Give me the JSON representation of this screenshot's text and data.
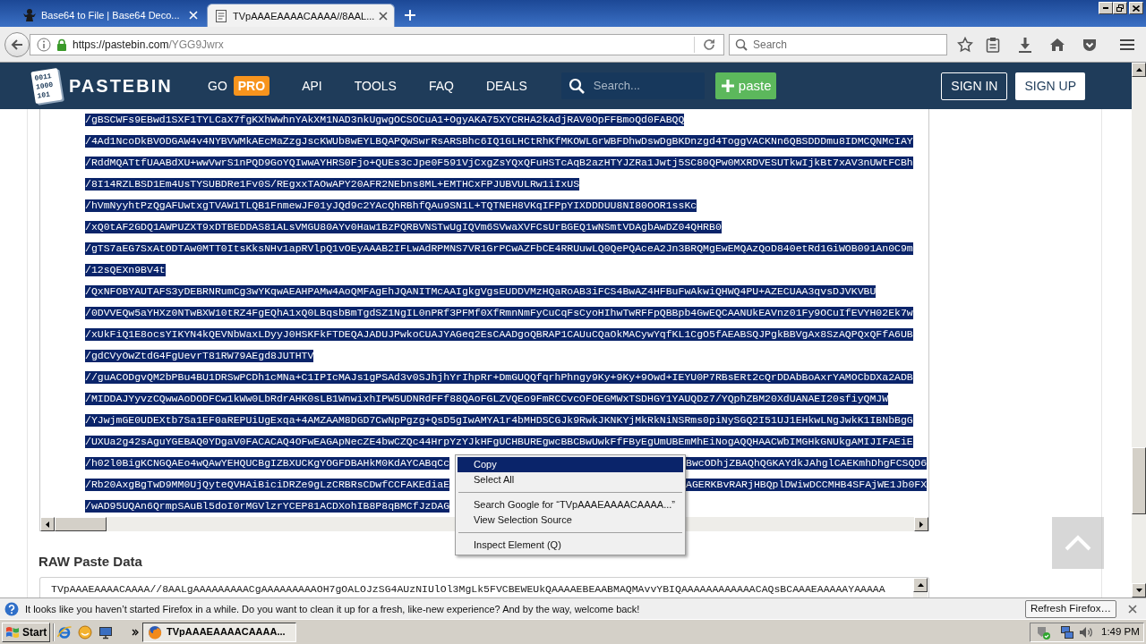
{
  "browser": {
    "tabs": [
      {
        "title": "Base64 to File | Base64 Deco...",
        "selected": false
      },
      {
        "title": "TVpAAAEAAAACAAAA//8AAL...",
        "selected": true
      }
    ],
    "address": {
      "host": "https://pastebin.com",
      "path": "/YGG9Jwrx"
    },
    "search": {
      "placeholder": "Search"
    }
  },
  "site_header": {
    "logo_digits": [
      "0011",
      "1000",
      "101"
    ],
    "logo": "PASTEBIN",
    "nav": [
      {
        "label": "GO",
        "badge": "PRO"
      },
      {
        "label": "API"
      },
      {
        "label": "TOOLS"
      },
      {
        "label": "FAQ"
      },
      {
        "label": "DEALS"
      }
    ],
    "search": {
      "placeholder": "Search..."
    },
    "new_paste": "paste",
    "sign_in": "SIGN IN",
    "sign_up": "SIGN UP"
  },
  "code": {
    "lines": [
      {
        "text": "/gBSCWFs9EBwd1SXF1TYLCaX7fgKXhWwhnYAkXM1NAD3nkUgwgOCSOCuA1+OgyAKA75XYCRHA2kAdjRAV0OpFFBmoQd0FABQQ",
        "selected": true
      },
      {
        "text": "/4Ad1NcoDkBVODGAW4v4NYBVWMkAEcMaZzgJscKWUb8wEYLBQAPQWSwrRsARSBhc6IQ1GLHCtRhKfMKOWLGrWBFDhwDswDgBKDnzgd4ToggVACKNn6QBSDDDmu8IDMCQNMcIAY",
        "selected": true
      },
      {
        "text": "/RddMQATtfUAABdXU+wwVwrS1nPQD9GoYQIwwAYHRS0Fjo+QUEs3cJpe0F591VjCxgZsYQxQFuHSTcAqB2azHTYJZRa1Jwtj5SC80QPw0MXRDVESUTkwIjkBt7xAV3nUWtFCBh",
        "selected": true
      },
      {
        "text": "/8I14RZLBSD1Em4UsTYSUBDRe1Fv0S/REgxxTAOwAPY20AFR2NEbns8ML+EMTHCxFPJUBVULRw1iIxUS",
        "selected": true
      },
      {
        "text": "/hVmNyyhtPzQgAFUwtxgTVAW1TLQB1FnmewJF01yJQd9c2YAcQhRBhfQAu9SN1L+TQTNEH8VKqIFPpYIXDDDUU8NI80OOR1ssKc",
        "selected": true
      },
      {
        "text": "/xQ0tAF2GDQ1AWPUZXT9xDTBEDDAS81ALsVMGU80AYv0Haw1BzPQRBVNSTwUgIQVm6SVwaXVFCsUrBGEQ1wNSmtVDAgbAwDZ04QHRB0",
        "selected": true
      },
      {
        "text": "/gTS7aEG7SxAtODTAw0MTT0ItsKksNHv1apRVlpQ1vOEyAAAB2IFLwAdRPMNS7VR1GrPCwAZFbCE4RRUuwLQ0QePQAceA2Jn3BRQMgEwEMQAzQoD840etRd1GiWOB091An0C9m",
        "selected": true
      },
      {
        "text": "/12sQEXn9BV4t",
        "selected": true
      },
      {
        "text": "/QxNFOBYAUTAFS3yDEBRNRumCg3wYKqwAEAHPAMw4AoQMFAgEhJQANITMcAAIgkgVgsEUDDVMzHQaRoAB3iFCS4BwAZ4HFBuFwAkwiQHWQ4PU+AZECUAA3qvsDJVKVBU",
        "selected": true
      },
      {
        "text": "/0DVVEQw5aYHXz0NTwBXW10tRZ4FgEQhA1xQ0LBqsbBmTgdSZ1NgIL0nPRf3PFMf0XfRmnNmFyCuCqFsCyoHIhwTwRFFpQBBpb4GwEQCAANUkEAVnz01Fy9OCuIfEVYH02Ek7w",
        "selected": true
      },
      {
        "text": "/xUkFiQ1E8ocsYIKYN4kQEVNbWaxLDyyJ0HSKFkFTDEQAJADUJPwkoCUAJYAGeq2EsCAADgoQBRAP1CAUuCQaOkMACywYqfKL1CgO5fAEABSQJPgkBBVgAx8SzAQPQxQFfA6UB",
        "selected": true
      },
      {
        "text": "/gdCVyOwZtdG4FgUevrT81RW79AEgd8JUTHTV",
        "selected": true
      },
      {
        "text": "//guACODgvQM2bPBu4BU1DRSwPCDh1cMNa+C1IPIcMAJs1gPSAd3v0SJhjhYrIhpRr+DmGUQQfqrhPhngy9Ky+9Ky+9Owd+IEYU0P7RBsERt2cQrDDAbBoAxrYAMOCbDXa2ADB",
        "selected": true
      },
      {
        "text": "/MIDDAJYyvzCQwwAoDODFCw1kWw0LbRdrAHK0sLB1WnwixhIPW5UDNRdFFf88QAoFGLZVQEo9FmRCCvcOFOEGMWxTSDHGY1YAUQDz7/YQphZBM20XdUANAEI20sfiyQMJW",
        "selected": true
      },
      {
        "text": "/YJwjmGE0UDEXtb7Sa1EF0aREPUiUgExqa+4AMZAAM8DGD7CwNpPgzg+QsD5gIwAMYA1r4bMHDSCGJk9RwkJKNKYjMkRkNiNSRms0piNySGQ2I51UJ1EHkwLNgJwkK1IBNbBgG",
        "selected": true
      },
      {
        "text": "/UXUa2g42sAguYGEBAQ0YDgaV0FACACAQ4OFwEAGApNecZE4bwCZQc44HrpYzYJkHFgUCHBUREgwcBBCBwUwkFfFByEgUmUBEmMhEiNogAQQHAACWbIMGHkGNUkgAMIJIFAEiE",
        "selected": true
      },
      {
        "text": "/h02l0BigKCNGQAEo4wQAwYEHQUCBgIZBXUCKgYOGFDBAHkM0KdAYCABqCc",
        "text_after": "BwcODhjZBAQhQGKAYdkJAhglCAEKmhDhgFCSQD6",
        "selected": true
      },
      {
        "text": "/Rb20AxgBgTwD9MM0UjQyteQVHAiBiciDRZe9gLzCRBRsCDwfCCFAKEdiaE",
        "text_after": "AGERKBvRARjHBQplDWiwDCCMHB4SFAjWE1Jb0FX",
        "selected": true
      },
      {
        "text": "/wAD95UQAn6QrmpSAuBl5doI0rMGVlzrYCEP81ACDXohIB8P8qBMCfJzDAG",
        "selected": true
      }
    ]
  },
  "raw_paste": {
    "heading": "RAW Paste Data",
    "value": "TVpAAAEAAAACAAAA//8AALgAAAAAAAAACgAAAAAAAAAOH7gOALOJzSG4AUzNIUlOl3MgLk5FVCBEWEUkQAAAAEBEAABMAQMAvvYBIQAAAAAAAAAAAACAQsBCAAAEAAAAAYAAAAA"
  },
  "context_menu": {
    "items": [
      {
        "kind": "item",
        "label": "Copy",
        "selected": true
      },
      {
        "kind": "item",
        "label": "Select All",
        "selected": false
      },
      {
        "kind": "separator"
      },
      {
        "kind": "item",
        "label": "Search Google for “TVpAAAEAAAACAAAA...”",
        "selected": false
      },
      {
        "kind": "item",
        "label": "View Selection Source",
        "selected": false
      },
      {
        "kind": "separator"
      },
      {
        "kind": "item",
        "label": "Inspect Element (Q)",
        "selected": false
      }
    ]
  },
  "notification": {
    "message": "It looks like you haven’t started Firefox in a while. Do you want to clean it up for a fresh, like-new experience? And by the way, welcome back!",
    "button": "Refresh Firefox…"
  },
  "taskbar": {
    "start": "Start",
    "tasks": [
      {
        "title": "TVpAAAEAAAACAAAA...",
        "selected": true
      }
    ],
    "clock": "1:49 PM"
  }
}
